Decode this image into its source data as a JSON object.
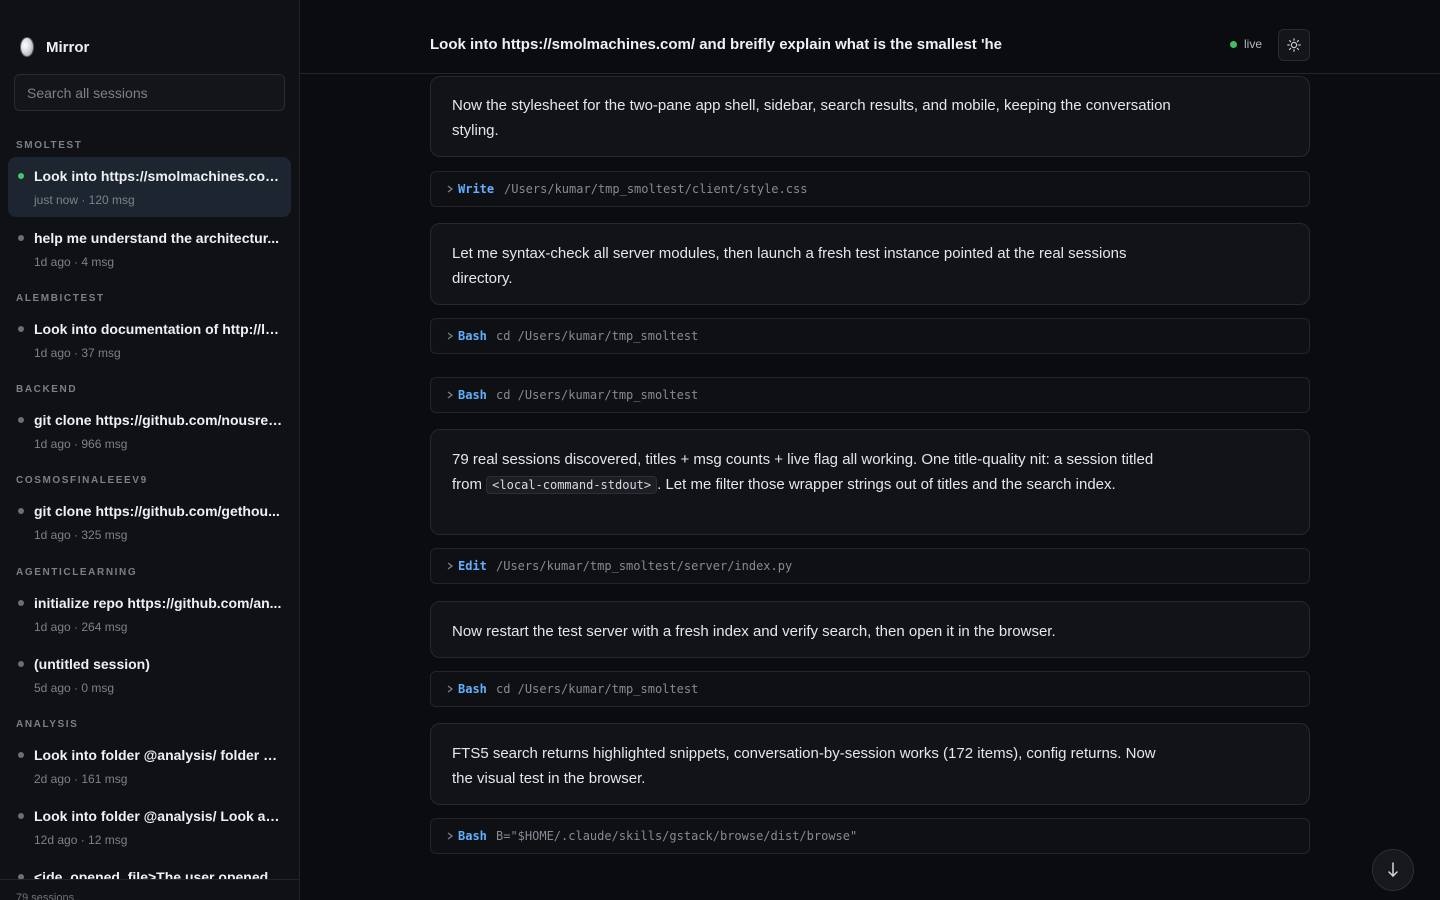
{
  "app": {
    "name": "Mirror"
  },
  "search": {
    "placeholder": "Search all sessions"
  },
  "sidebar": {
    "groups": [
      {
        "label": "SMOLTEST"
      },
      {
        "label": "ALEMBICTEST"
      },
      {
        "label": "BACKEND"
      },
      {
        "label": "COSMOSFINALEEEV9"
      },
      {
        "label": "AGENTICLEARNING"
      },
      {
        "label": "ANALYSIS"
      }
    ],
    "sessions": [
      {
        "title": "Look into https://smolmachines.com...",
        "meta": "just now · 120 msg",
        "active": true
      },
      {
        "title": "help me understand the architectur...",
        "meta": "1d ago · 4 msg"
      },
      {
        "title": "Look into documentation of http://lo...",
        "meta": "1d ago · 37 msg"
      },
      {
        "title": "git clone https://github.com/nousres...",
        "meta": "1d ago · 966 msg"
      },
      {
        "title": "git clone https://github.com/gethou...",
        "meta": "1d ago · 325 msg"
      },
      {
        "title": "initialize repo https://github.com/an...",
        "meta": "1d ago · 264 msg"
      },
      {
        "title": "(untitled session)",
        "meta": "5d ago · 0 msg"
      },
      {
        "title": "Look into folder @analysis/ folder Lo...",
        "meta": "2d ago · 161 msg"
      },
      {
        "title": "Look into folder @analysis/ Look at t...",
        "meta": "12d ago · 12 msg"
      },
      {
        "title": "<ide_opened_file>The user opened...",
        "meta": ""
      }
    ],
    "footer": "79 sessions"
  },
  "header": {
    "title": "Look into https://smolmachines.com/ and breifly explain what is the smallest 'he",
    "live_label": "live"
  },
  "messages": {
    "m1": "Now the stylesheet for the two-pane app shell, sidebar, search results, and mobile, keeping the conversation styling.",
    "m2": "Let me syntax-check all server modules, then launch a fresh test instance pointed at the real sessions directory.",
    "m3_before": "79 real sessions discovered, titles + msg counts + live flag all working. One title-quality nit: a session titled from ",
    "m3_code": "<local-command-stdout>",
    "m3_after": ". Let me filter those wrapper strings out of titles and the search index.",
    "m4": "Now restart the test server with a fresh index and verify search, then open it in the browser.",
    "m5": "FTS5 search returns highlighted snippets, conversation-by-session works (172 items), config returns. Now the visual test in the browser."
  },
  "tools": [
    {
      "name": "Write",
      "arg": "/Users/kumar/tmp_smoltest/client/style.css"
    },
    {
      "name": "Bash",
      "arg": "cd /Users/kumar/tmp_smoltest"
    },
    {
      "name": "Bash",
      "arg": "cd /Users/kumar/tmp_smoltest"
    },
    {
      "name": "Edit",
      "arg": "/Users/kumar/tmp_smoltest/server/index.py"
    },
    {
      "name": "Bash",
      "arg": "cd /Users/kumar/tmp_smoltest"
    },
    {
      "name": "Bash",
      "arg": "B=\"$HOME/.claude/skills/gstack/browse/dist/browse\""
    }
  ],
  "colors": {
    "accent": "#5fb0ff",
    "live": "#3fbf63",
    "active_session_bg": "#1c2530"
  },
  "icons": {
    "theme": "sun-icon",
    "scroll": "arrow-down-icon",
    "tool_expand": "chevron-right-icon"
  }
}
